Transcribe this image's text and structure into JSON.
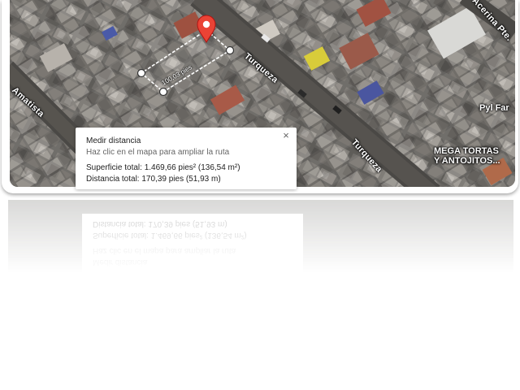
{
  "map": {
    "streets": {
      "turqueza_upper": "Turqueza",
      "turqueza_lower": "Turqueza",
      "amatista": "Amatista",
      "acerina": "Acerina Pte."
    },
    "pois": {
      "pyl": "Pyl Far",
      "mega_line1": "MEGA TORTAS",
      "mega_line2": "Y ANTOJITOS..."
    },
    "measure_segment_label": "100,03 pies",
    "marker_color": "#ea4335"
  },
  "panel": {
    "title": "Medir distancia",
    "hint": "Haz clic en el mapa para ampliar la ruta",
    "area": "Superficie total: 1.469,66 pies² (136,54 m²)",
    "distance": "Distancia total: 170,39 pies (51,93 m)",
    "close": "×"
  }
}
